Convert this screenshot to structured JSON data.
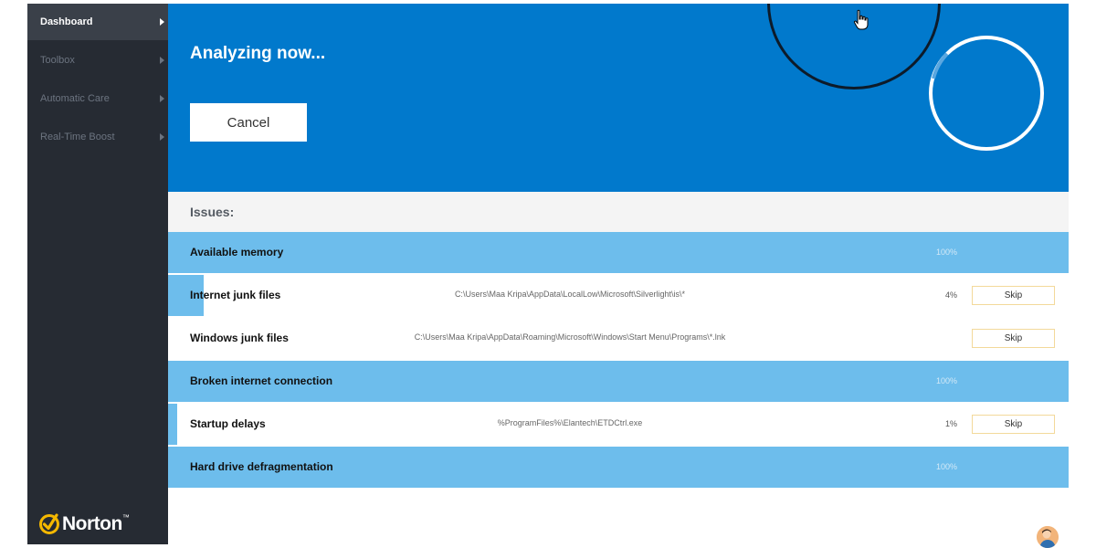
{
  "sidebar": {
    "items": [
      {
        "label": "Dashboard",
        "active": true
      },
      {
        "label": "Toolbox",
        "active": false
      },
      {
        "label": "Automatic Care",
        "active": false
      },
      {
        "label": "Real-Time Boost",
        "active": false
      }
    ],
    "brand": {
      "name": "Norton",
      "trademark": "™"
    }
  },
  "header": {
    "title": "Analyzing now...",
    "cancel_label": "Cancel"
  },
  "issues": {
    "label": "Issues:",
    "rows": [
      {
        "name": "Available memory",
        "path": "",
        "percent": "100%",
        "progress": 1.0,
        "skip": ""
      },
      {
        "name": "Internet junk files",
        "path": "C:\\Users\\Maa Kripa\\AppData\\LocalLow\\Microsoft\\Silverlight\\is\\*",
        "percent": "4%",
        "progress": 0.04,
        "skip": "Skip"
      },
      {
        "name": "Windows junk files",
        "path": "C:\\Users\\Maa Kripa\\AppData\\Roaming\\Microsoft\\Windows\\Start Menu\\Programs\\*.lnk",
        "percent": "",
        "progress": 0.0,
        "skip": "Skip"
      },
      {
        "name": "Broken internet connection",
        "path": "",
        "percent": "100%",
        "progress": 1.0,
        "skip": ""
      },
      {
        "name": "Startup delays",
        "path": "%ProgramFiles%\\Elantech\\ETDCtrl.exe",
        "percent": "1%",
        "progress": 0.01,
        "skip": "Skip"
      },
      {
        "name": "Hard drive defragmentation",
        "path": "",
        "percent": "100%",
        "progress": 1.0,
        "skip": ""
      }
    ]
  },
  "colors": {
    "accent": "#0179cc",
    "sidebar": "#262b33",
    "progress_fill": "#6dbdec",
    "brand_yellow": "#f5b800"
  }
}
